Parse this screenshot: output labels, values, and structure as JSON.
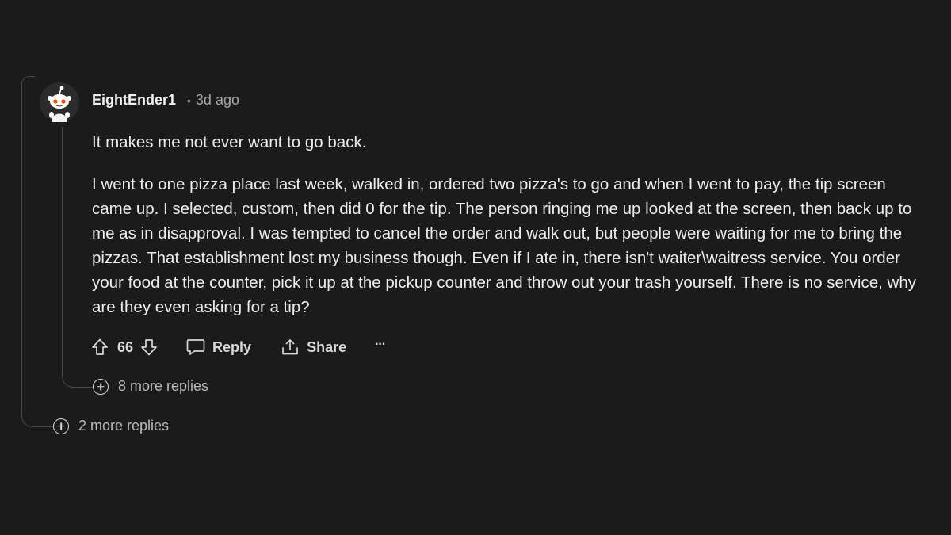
{
  "comment": {
    "author": "EightEnder1",
    "separator": "•",
    "time": "3d ago",
    "paragraphs": [
      "It makes me not ever want to go back.",
      "I went to one pizza place last week, walked in, ordered two pizza's to go and when I went to pay, the tip screen came up. I selected, custom, then did 0 for the tip. The person ringing me up looked at the screen, then back up to me as in disapproval. I was tempted to cancel the order and walk out, but people were waiting for me to bring the pizzas. That establishment lost my business though. Even if I ate in, there isn't waiter\\waitress service. You order your food at the counter, pick it up at the pickup counter and throw out your trash yourself. There is no service, why are they even asking for a tip?"
    ],
    "actions": {
      "upvote_icon": "arrow-up-outline-icon",
      "vote_count": "66",
      "downvote_icon": "arrow-down-outline-icon",
      "reply_label": "Reply",
      "reply_icon": "speech-bubble-icon",
      "share_label": "Share",
      "share_icon": "share-upload-icon",
      "overflow_label": "···"
    },
    "nested_more_replies": "8 more replies"
  },
  "parent_more_replies": "2 more replies",
  "colors": {
    "background": "#1b1b1b",
    "text": "#ededed",
    "muted": "#a6a6a6",
    "thread_line": "#4a4a4a"
  }
}
